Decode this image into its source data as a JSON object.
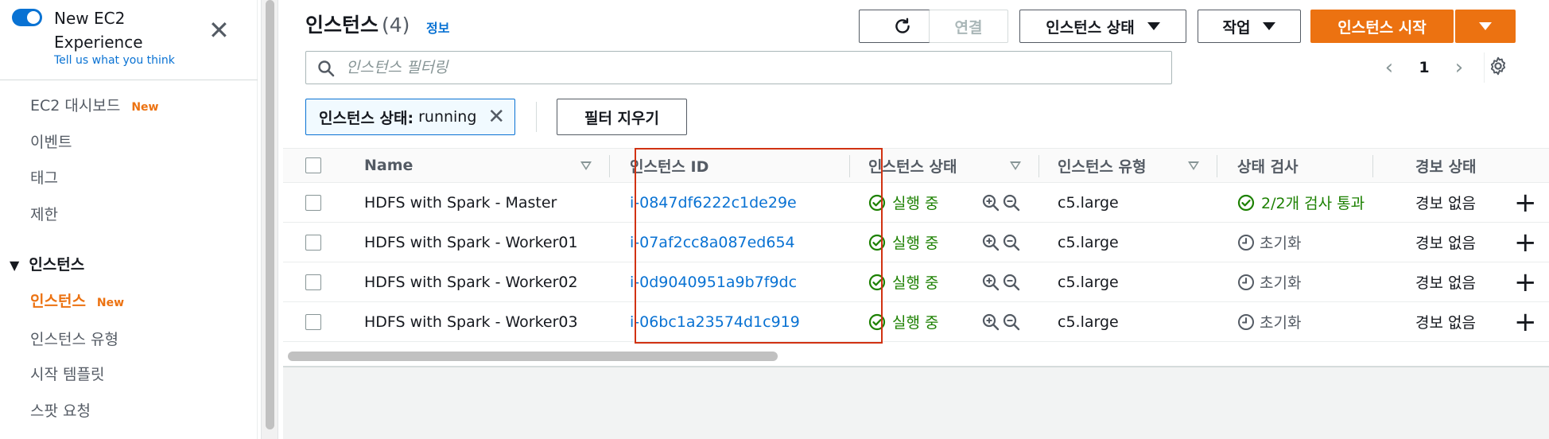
{
  "sidebar": {
    "experience_title": "New EC2 Experience",
    "experience_feedback": "Tell us what you think",
    "items": [
      {
        "label": "EC2 대시보드",
        "badge": "New"
      },
      {
        "label": "이벤트"
      },
      {
        "label": "태그"
      },
      {
        "label": "제한"
      }
    ],
    "section": "인스턴스",
    "section_items": [
      {
        "label": "인스턴스",
        "badge": "New"
      },
      {
        "label": "인스턴스 유형"
      },
      {
        "label": "시작 템플릿"
      },
      {
        "label": "스팟 요청"
      }
    ]
  },
  "header": {
    "title": "인스턴스",
    "count": "(4)",
    "info": "정보",
    "connect_label": "연결",
    "state_label": "인스턴스 상태",
    "actions_label": "작업",
    "launch_label": "인스턴스 시작"
  },
  "filter": {
    "placeholder": "인스턴스 필터링",
    "token_key": "인스턴스 상태:",
    "token_value": "running",
    "clear_label": "필터 지우기"
  },
  "pagination": {
    "page": "1"
  },
  "table": {
    "columns": [
      "Name",
      "인스턴스 ID",
      "인스턴스 상태",
      "인스턴스 유형",
      "상태 검사",
      "경보 상태"
    ],
    "rows": [
      {
        "name": "HDFS with Spark - Master",
        "id": "i-0847df6222c1de29e",
        "state": "실행 중",
        "type": "c5.large",
        "check": "2/2개 검사 통과",
        "check_status": "passed",
        "alarm": "경보 없음"
      },
      {
        "name": "HDFS with Spark - Worker01",
        "id": "i-07af2cc8a087ed654",
        "state": "실행 중",
        "type": "c5.large",
        "check": "초기화",
        "check_status": "initializing",
        "alarm": "경보 없음"
      },
      {
        "name": "HDFS with Spark - Worker02",
        "id": "i-0d9040951a9b7f9dc",
        "state": "실행 중",
        "type": "c5.large",
        "check": "초기화",
        "check_status": "initializing",
        "alarm": "경보 없음"
      },
      {
        "name": "HDFS with Spark - Worker03",
        "id": "i-06bc1a23574d1c919",
        "state": "실행 중",
        "type": "c5.large",
        "check": "초기화",
        "check_status": "initializing",
        "alarm": "경보 없음"
      }
    ]
  },
  "colors": {
    "accent": "#ec7211",
    "link": "#0972d3",
    "success": "#1d8102",
    "highlight": "#d13212"
  }
}
